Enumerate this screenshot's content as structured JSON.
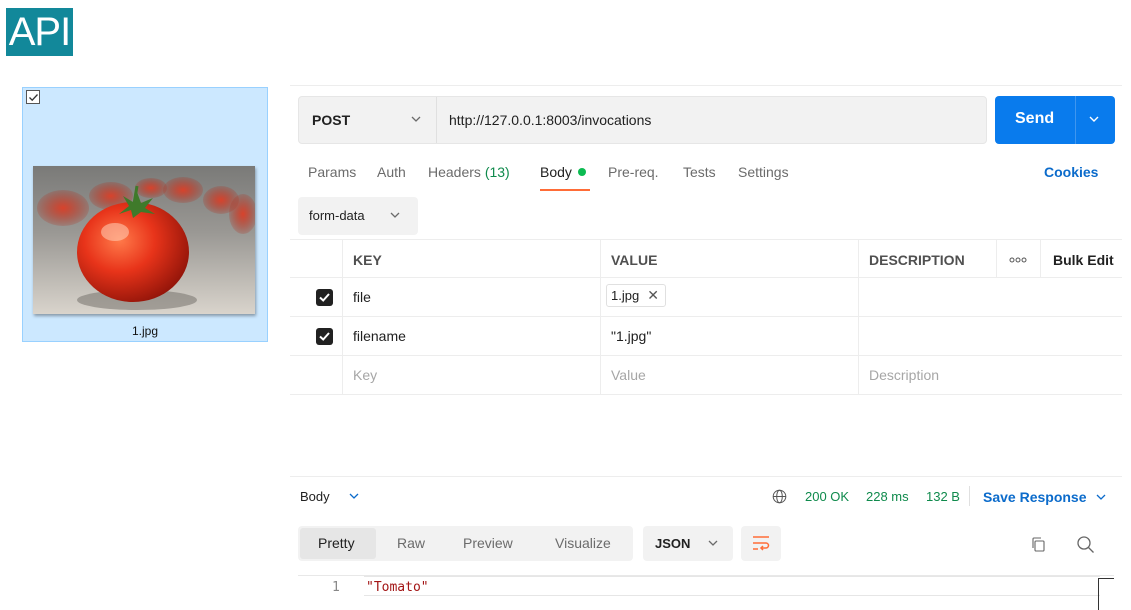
{
  "badge": {
    "text": "API"
  },
  "file": {
    "name": "1.jpg"
  },
  "request": {
    "method": "POST",
    "url": "http://127.0.0.1:8003/invocations",
    "send_label": "Send"
  },
  "tabs": [
    {
      "label": "Params"
    },
    {
      "label": "Auth"
    },
    {
      "label": "Headers",
      "count": "(13)"
    },
    {
      "label": "Body"
    },
    {
      "label": "Pre-req."
    },
    {
      "label": "Tests"
    },
    {
      "label": "Settings"
    }
  ],
  "cookies_label": "Cookies",
  "body_mode": "form-data",
  "table": {
    "headers": {
      "key": "KEY",
      "value": "VALUE",
      "description": "DESCRIPTION",
      "bulk_edit": "Bulk Edit"
    },
    "rows": [
      {
        "key": "file",
        "value": "1.jpg",
        "checked": true
      },
      {
        "key": "filename",
        "value": "\"1.jpg\"",
        "checked": true
      }
    ],
    "placeholders": {
      "key": "Key",
      "value": "Value",
      "description": "Description"
    }
  },
  "response": {
    "body_label": "Body",
    "status": "200 OK",
    "time": "228 ms",
    "size": "132 B",
    "save_label": "Save Response",
    "view_tabs": [
      "Pretty",
      "Raw",
      "Preview",
      "Visualize"
    ],
    "format": "JSON",
    "lines": [
      {
        "number": "1",
        "text": "\"Tomato\""
      }
    ]
  },
  "colors": {
    "accent_blue": "#097bed",
    "badge": "#12889a",
    "status_green": "#0f8a4c",
    "tab_underline": "#ff6c37"
  }
}
